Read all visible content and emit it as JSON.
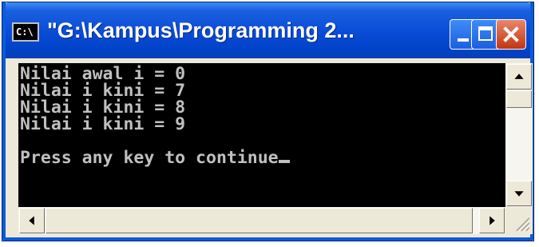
{
  "window": {
    "title": "\"G:\\Kampus\\Programming 2...",
    "icon_label": "C:\\",
    "controls": {
      "minimize": "minimize-icon",
      "maximize": "maximize-icon",
      "close": "close-icon"
    }
  },
  "console": {
    "lines": [
      "Nilai awal i = 0",
      "Nilai i kini = 7",
      "Nilai i kini = 8",
      "Nilai i kini = 9",
      "",
      "Press any key to continue"
    ]
  },
  "colors": {
    "titlebar": "#0a4bd6",
    "console_bg": "#000000",
    "console_fg": "#c0c0c0",
    "close_button": "#c43510"
  }
}
